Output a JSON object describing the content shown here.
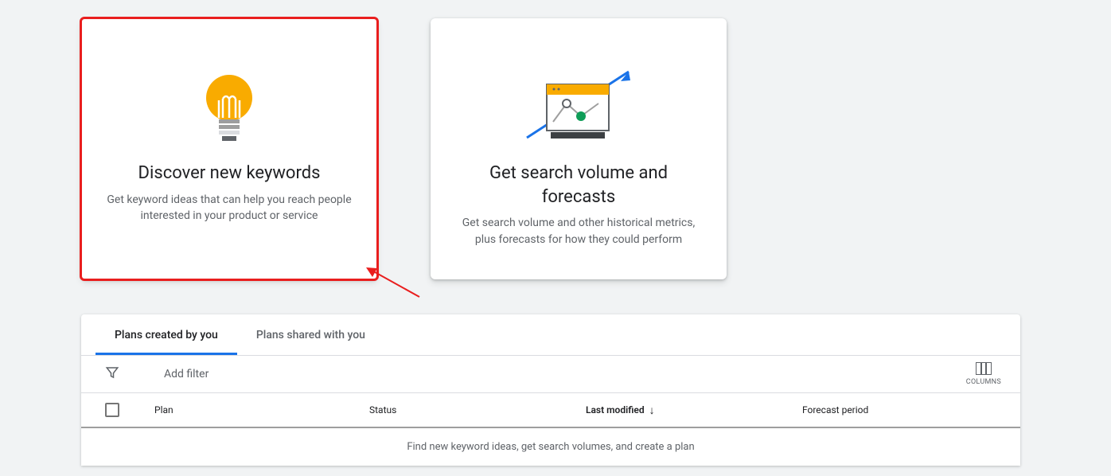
{
  "cards": {
    "discover": {
      "title": "Discover new keywords",
      "desc": "Get keyword ideas that can help you reach people interested in your product or service"
    },
    "forecast": {
      "title": "Get search volume and forecasts",
      "desc": "Get search volume and other historical metrics, plus forecasts for how they could perform"
    }
  },
  "tabs": {
    "created": "Plans created by you",
    "shared": "Plans shared with you"
  },
  "filter": {
    "add": "Add filter",
    "columns": "COLUMNS"
  },
  "table": {
    "headers": {
      "plan": "Plan",
      "status": "Status",
      "lastmod": "Last modified",
      "forecast": "Forecast period"
    },
    "empty": "Find new keyword ideas, get search volumes, and create a plan"
  }
}
